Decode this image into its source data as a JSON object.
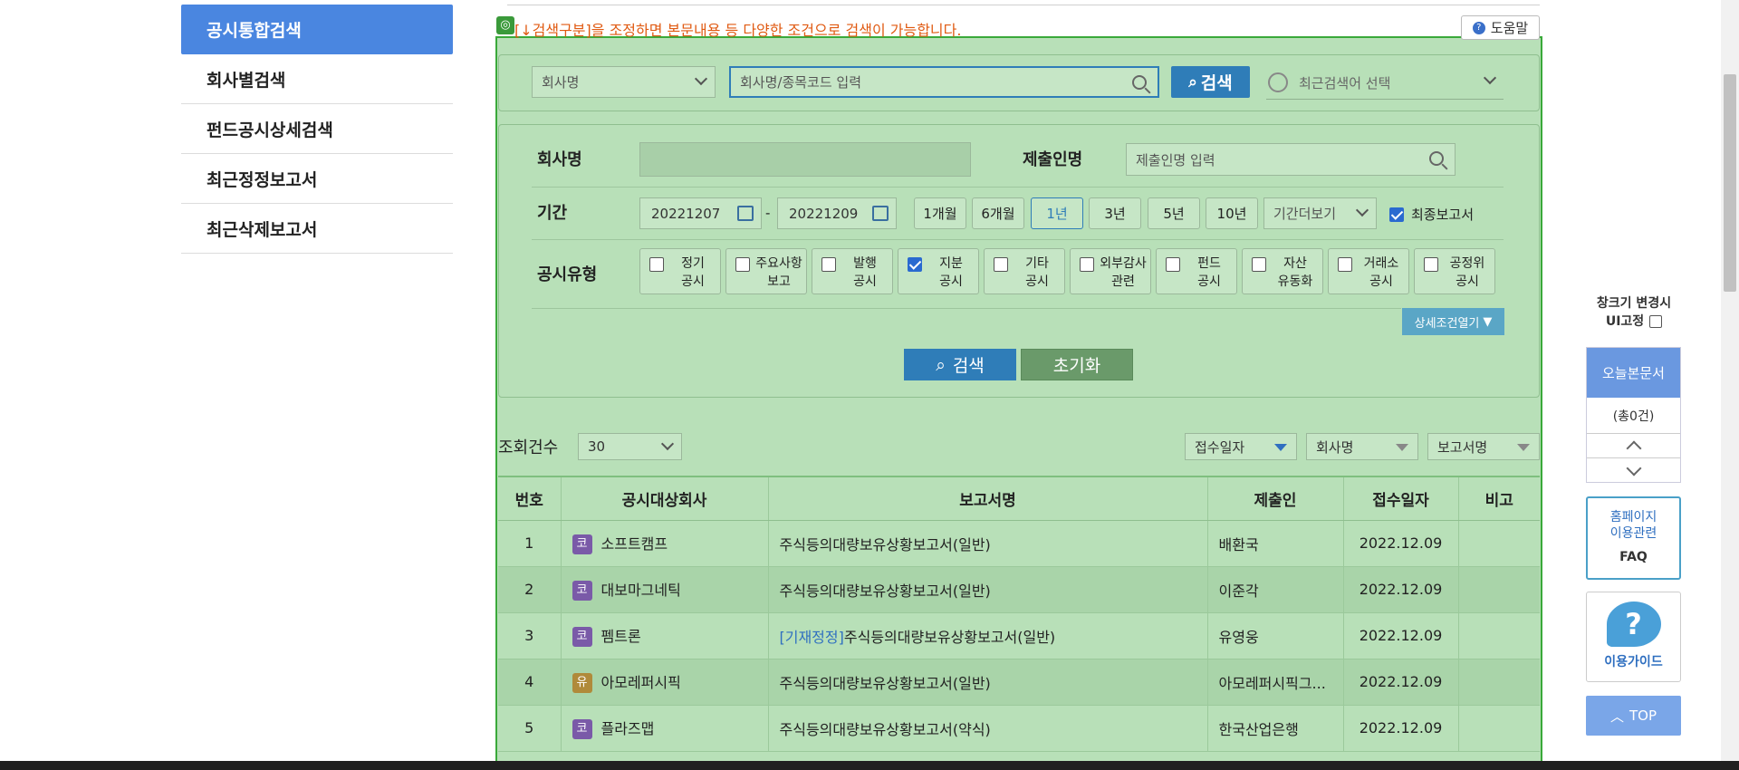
{
  "sidebar": {
    "items": [
      {
        "label": "공시통합검색",
        "active": true
      },
      {
        "label": "회사별검색"
      },
      {
        "label": "펀드공시상세검색"
      },
      {
        "label": "최근정정보고서"
      },
      {
        "label": "최근삭제보고서"
      }
    ]
  },
  "notice": {
    "text": "[↓검색구분]을 조정하면 본문내용 등 다양한 조건으로 검색이 가능합니다.",
    "icon": "target-icon"
  },
  "help": {
    "label": "도움말"
  },
  "search": {
    "type_select": "회사명",
    "input_placeholder": "회사명/종목코드 입력",
    "button": "검색",
    "recent_placeholder": "최근검색어 선택"
  },
  "filters": {
    "company_label": "회사명",
    "company_value": "",
    "submitter_label": "제출인명",
    "submitter_placeholder": "제출인명 입력",
    "period_label": "기간",
    "date_from": "20221207",
    "date_sep": "-",
    "date_to": "20221209",
    "periods": [
      {
        "label": "1개월"
      },
      {
        "label": "6개월"
      },
      {
        "label": "1년",
        "active": true
      },
      {
        "label": "3년"
      },
      {
        "label": "5년"
      },
      {
        "label": "10년"
      }
    ],
    "more_period": "기간더보기",
    "final_report_label": "최종보고서",
    "final_report_checked": true,
    "type_label": "공시유형",
    "types": [
      {
        "line1": "정기",
        "line2": "공시",
        "checked": false
      },
      {
        "line1": "주요사항",
        "line2": "보고",
        "checked": false
      },
      {
        "line1": "발행",
        "line2": "공시",
        "checked": false
      },
      {
        "line1": "지분",
        "line2": "공시",
        "checked": true
      },
      {
        "line1": "기타",
        "line2": "공시",
        "checked": false
      },
      {
        "line1": "외부감사",
        "line2": "관련",
        "checked": false
      },
      {
        "line1": "펀드",
        "line2": "공시",
        "checked": false
      },
      {
        "line1": "자산",
        "line2": "유동화",
        "checked": false
      },
      {
        "line1": "거래소",
        "line2": "공시",
        "checked": false
      },
      {
        "line1": "공정위",
        "line2": "공시",
        "checked": false
      }
    ],
    "detail_button": "상세조건열기",
    "search_button": "검색",
    "reset_button": "초기화"
  },
  "results": {
    "count_label": "조회건수",
    "count_value": "30",
    "sort_options": [
      "접수일자",
      "회사명",
      "보고서명"
    ],
    "headers": [
      "번호",
      "공시대상회사",
      "보고서명",
      "제출인",
      "접수일자",
      "비고"
    ],
    "rows": [
      {
        "no": "1",
        "market": "코",
        "company": "소프트캠프",
        "prefix": "",
        "report": "주식등의대량보유상황보고서(일반)",
        "submitter": "배환국",
        "date": "2022.12.09",
        "note": ""
      },
      {
        "no": "2",
        "market": "코",
        "company": "대보마그네틱",
        "prefix": "",
        "report": "주식등의대량보유상황보고서(일반)",
        "submitter": "이준각",
        "date": "2022.12.09",
        "note": ""
      },
      {
        "no": "3",
        "market": "코",
        "company": "펨트론",
        "prefix": "[기재정정]",
        "report": "주식등의대량보유상황보고서(일반)",
        "submitter": "유영웅",
        "date": "2022.12.09",
        "note": ""
      },
      {
        "no": "4",
        "market": "유",
        "company": "아모레퍼시픽",
        "prefix": "",
        "report": "주식등의대량보유상황보고서(일반)",
        "submitter": "아모레퍼시픽그...",
        "date": "2022.12.09",
        "note": ""
      },
      {
        "no": "5",
        "market": "코",
        "company": "플라즈맵",
        "prefix": "",
        "report": "주식등의대량보유상황보고서(약식)",
        "submitter": "한국산업은행",
        "date": "2022.12.09",
        "note": ""
      }
    ]
  },
  "right_panel": {
    "ui_fix_line1": "창크기 변경시",
    "ui_fix_line2": "UI고정",
    "today_docs": "오늘본문서",
    "today_count": "(총0건)",
    "faq_line1": "홈페이지",
    "faq_line2": "이용관련",
    "faq_line3": "FAQ",
    "guide": "이용가이드",
    "top": "TOP"
  },
  "colors": {
    "primary": "#2f7db8",
    "sidebar_active": "#4a86e0",
    "panel_bg": "#b8e0b8",
    "panel_border": "#3aa93a",
    "notice": "#e05a12"
  }
}
